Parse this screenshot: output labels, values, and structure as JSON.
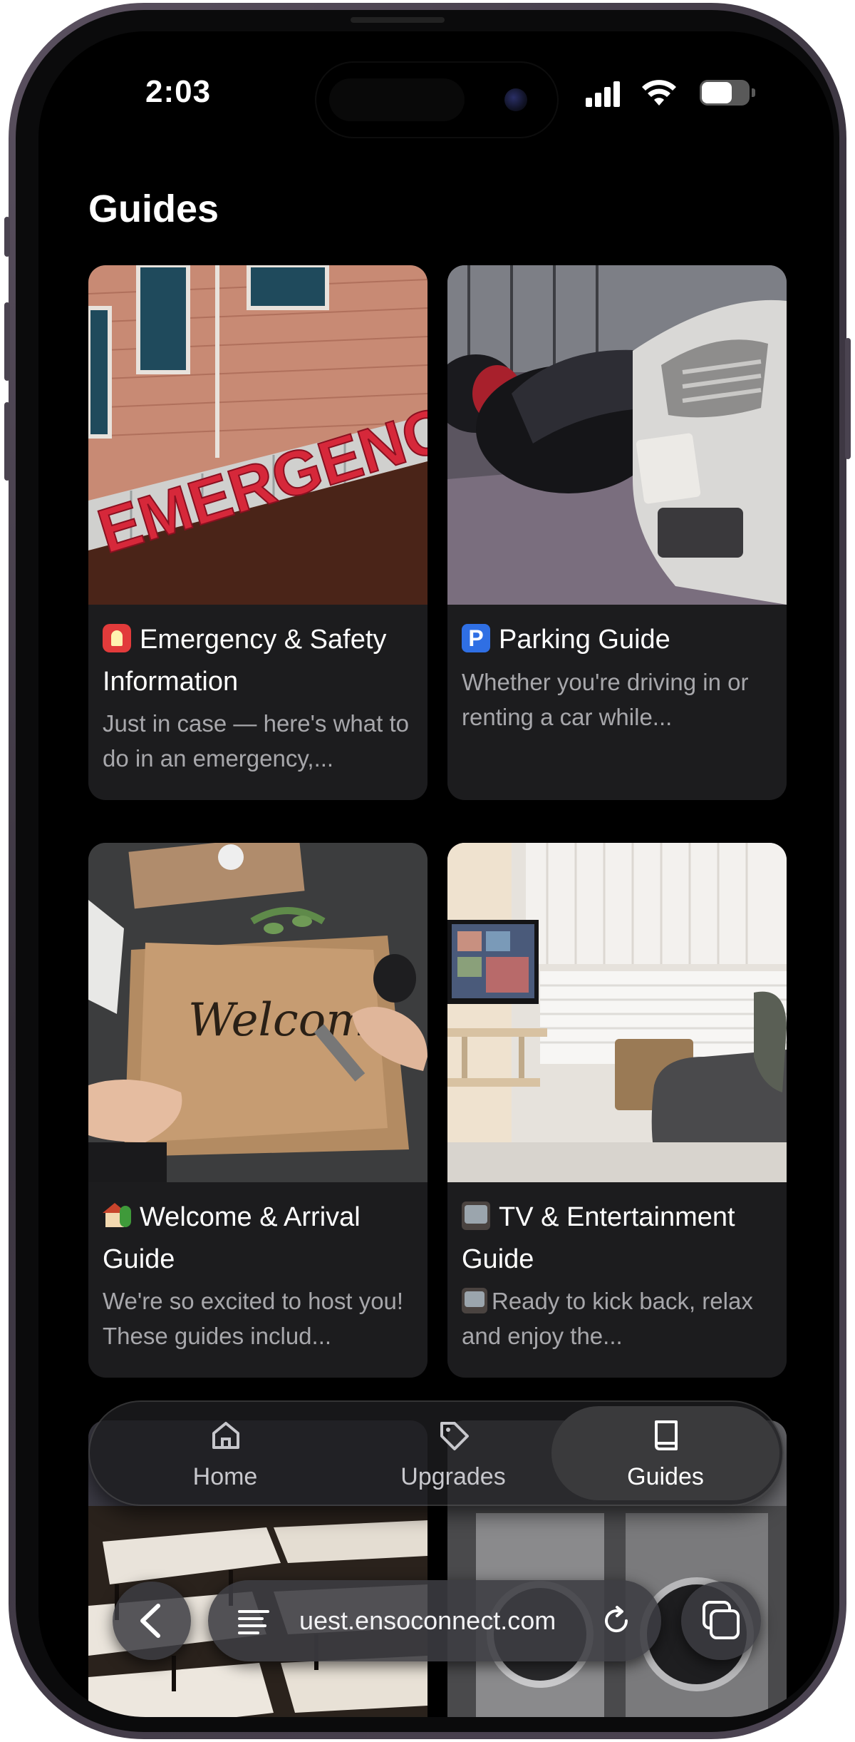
{
  "status_bar": {
    "time": "2:03"
  },
  "page": {
    "title": "Guides"
  },
  "guides": [
    {
      "emoji": "rotating-light",
      "title": "Emergency & Safety Information",
      "description": "Just in case — here's what to do in an emergency,..."
    },
    {
      "emoji": "parking-sign",
      "title": "Parking Guide",
      "description": "Whether you're driving in or renting a car while..."
    },
    {
      "emoji": "house-with-garden",
      "title": "Welcome & Arrival Guide",
      "description": "We're so excited to host you! These guides includ..."
    },
    {
      "emoji": "television",
      "title": "TV & Entertainment Guide",
      "description": "Ready to kick back, relax and enjoy the..."
    }
  ],
  "nav": {
    "items": [
      {
        "label": "Home",
        "icon": "home-icon"
      },
      {
        "label": "Upgrades",
        "icon": "tag-icon"
      },
      {
        "label": "Guides",
        "icon": "book-icon",
        "active": true
      }
    ]
  },
  "browser": {
    "url": "uest.ensoconnect.com"
  },
  "colors": {
    "background": "#000000",
    "card": "#1c1c1e",
    "muted_text": "#a7a7ab",
    "active_nav": "#3a3a3c"
  }
}
